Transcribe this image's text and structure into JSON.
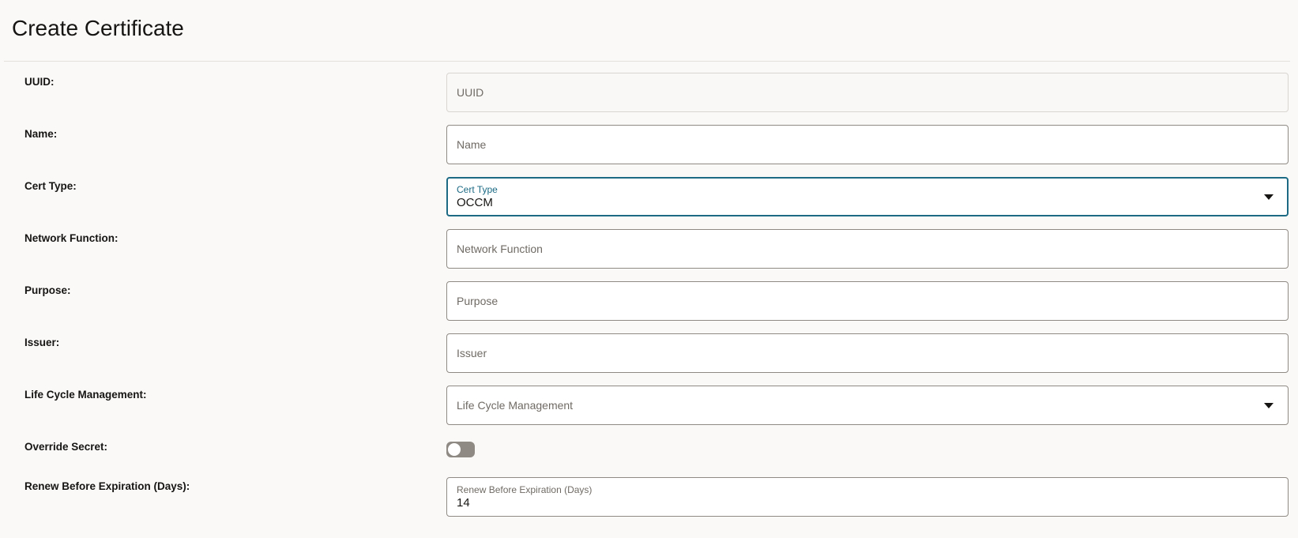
{
  "page": {
    "title": "Create Certificate"
  },
  "form": {
    "uuid": {
      "label": "UUID:",
      "placeholder": "UUID",
      "readonly": true
    },
    "name": {
      "label": "Name:",
      "placeholder": "Name"
    },
    "cert_type": {
      "label": "Cert Type:",
      "float_label": "Cert Type",
      "value": "OCCM",
      "icon": "chevron-down-icon"
    },
    "network_function": {
      "label": "Network Function:",
      "placeholder": "Network Function"
    },
    "purpose": {
      "label": "Purpose:",
      "placeholder": "Purpose"
    },
    "issuer": {
      "label": "Issuer:",
      "placeholder": "Issuer"
    },
    "life_cycle_management": {
      "label": "Life Cycle Management:",
      "placeholder": "Life Cycle Management",
      "icon": "chevron-down-icon"
    },
    "override_secret": {
      "label": "Override Secret:",
      "enabled": false
    },
    "renew_before_expiration": {
      "label": "Renew Before Expiration (Days):",
      "float_label": "Renew Before Expiration (Days)",
      "value": "14"
    }
  },
  "colors": {
    "background": "#faf9f8",
    "focus_border": "#1c6a84",
    "field_border": "#8f8a84",
    "toggle_off": "#8f8a84"
  }
}
